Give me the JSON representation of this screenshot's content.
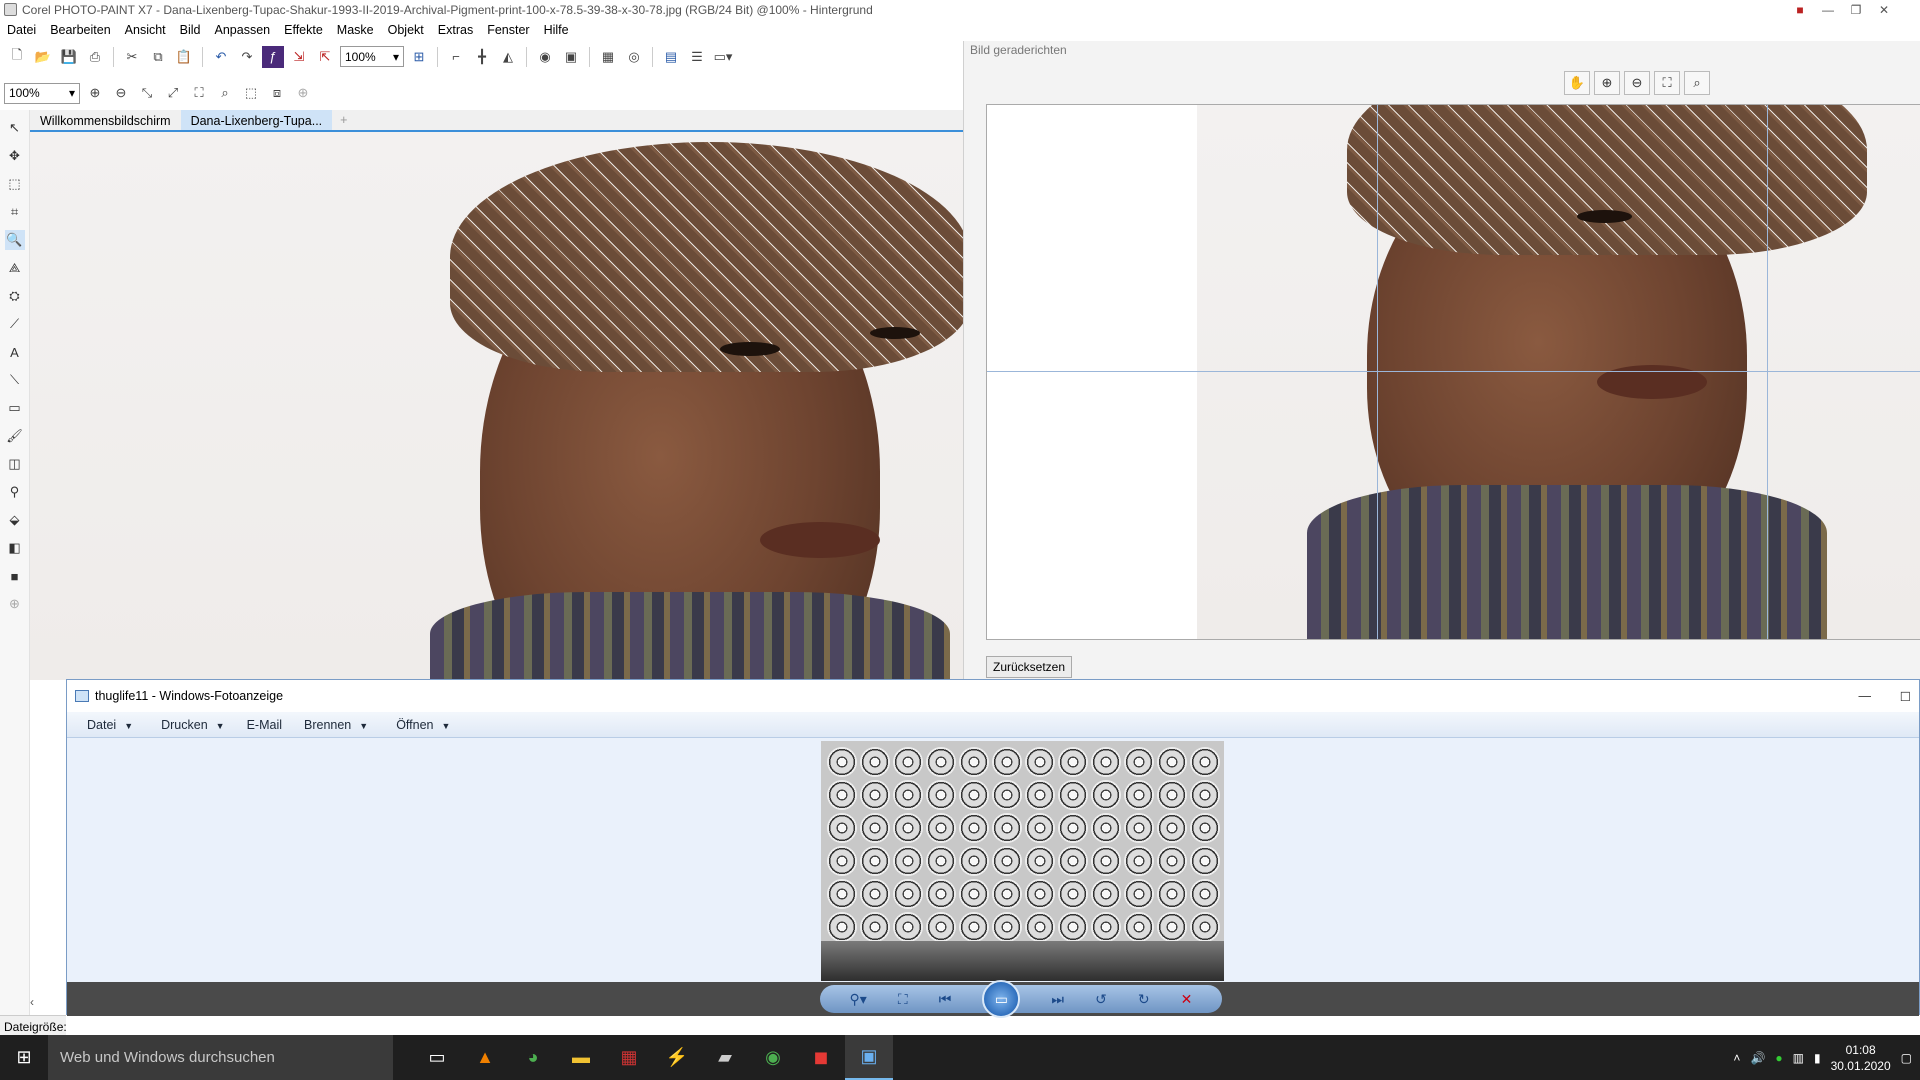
{
  "app": {
    "title": "Corel PHOTO-PAINT X7 - Dana-Lixenberg-Tupac-Shakur-1993-II-2019-Archival-Pigment-print-100-x-78.5-39-38-x-30-78.jpg (RGB/24 Bit) @100% - Hintergrund"
  },
  "menu": [
    "Datei",
    "Bearbeiten",
    "Ansicht",
    "Bild",
    "Anpassen",
    "Effekte",
    "Maske",
    "Objekt",
    "Extras",
    "Fenster",
    "Hilfe"
  ],
  "toolbar": {
    "zoom_value": "100%"
  },
  "toolbar2": {
    "zoom_value": "100%"
  },
  "tabs": [
    "Willkommensbildschirm",
    "Dana-Lixenberg-Tupa..."
  ],
  "straighten_panel": {
    "title": "Bild geraderichten",
    "reset_label": "Zurücksetzen"
  },
  "photo_viewer": {
    "title": "thuglife11 - Windows-Fotoanzeige",
    "menu": [
      "Datei",
      "Drucken",
      "E-Mail",
      "Brennen",
      "Öffnen"
    ]
  },
  "statusbar": {
    "text": "Dateigröße:"
  },
  "taskbar": {
    "search_placeholder": "Web und Windows durchsuchen",
    "time": "01:08",
    "date": "30.01.2020"
  },
  "icons": [
    "start-icon",
    "task-view-icon",
    "vlc-icon",
    "chrome-icon",
    "file-explorer-icon",
    "photo-paint-icon",
    "winamp-icon",
    "app-icon",
    "chrome-icon",
    "app-red-icon",
    "photo-viewer-icon"
  ],
  "colors": {
    "accent": "#3b8fd9",
    "viewer_bg": "#eaf1fb",
    "taskbar": "#1f1f1f"
  }
}
